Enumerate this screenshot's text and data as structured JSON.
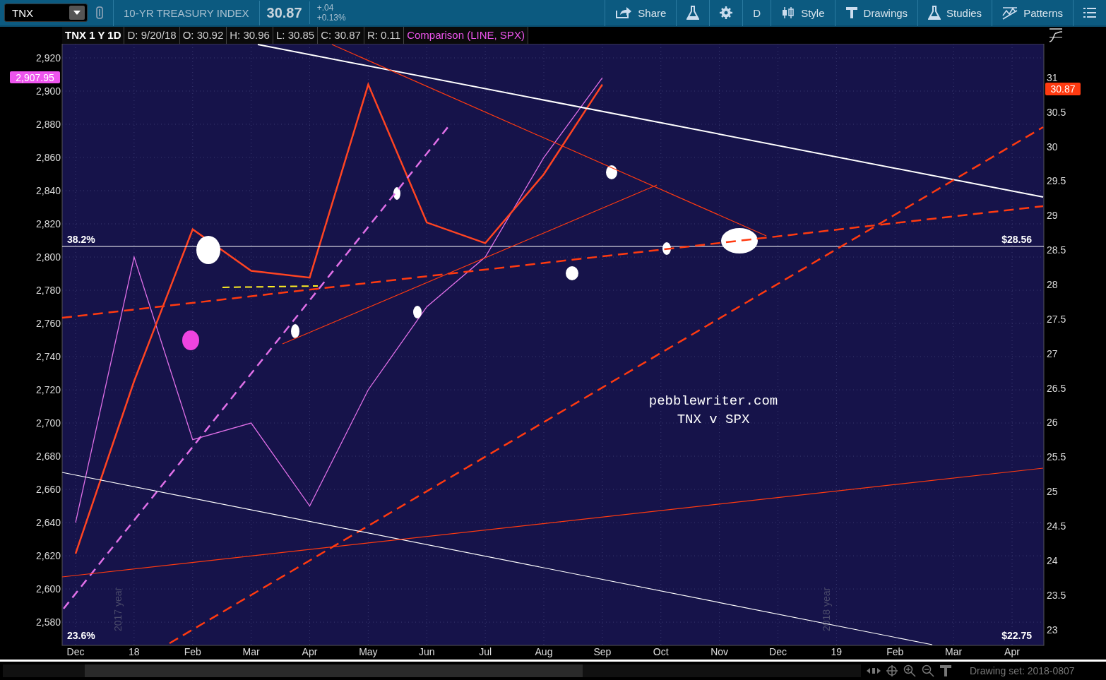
{
  "toolbar": {
    "symbol": "TNX",
    "description": "10-YR TREASURY INDEX",
    "last": "30.87",
    "change": "+.04",
    "change_percent": "+0.13%",
    "buttons": [
      {
        "kind": "share",
        "label": "Share"
      },
      {
        "kind": "flask"
      },
      {
        "kind": "gear"
      },
      {
        "kind": "text",
        "label": "D"
      },
      {
        "kind": "style",
        "label": "Style"
      },
      {
        "kind": "drawings",
        "label": "Drawings"
      },
      {
        "kind": "studies",
        "label": "Studies"
      },
      {
        "kind": "patterns",
        "label": "Patterns"
      },
      {
        "kind": "list"
      }
    ]
  },
  "header": {
    "title": "TNX 1 Y 1D",
    "fields": [
      "D: 9/20/18",
      "O: 30.92",
      "H: 30.96",
      "L: 30.85",
      "C: 30.87",
      "R: 0.11"
    ],
    "comparison": "Comparison (LINE, SPX)"
  },
  "chart": {
    "left_badge": "2,907.95",
    "right_badge": "30.87",
    "fib_levels": [
      {
        "percent": "38.2%",
        "price": "$28.56",
        "kind": "upper"
      },
      {
        "percent": "23.6%",
        "price": "$22.75",
        "kind": "lower"
      }
    ],
    "note_lines": [
      "pebblewriter.com",
      "TNX  v  SPX"
    ],
    "year_marks": [
      "2017 year",
      "2018 year"
    ],
    "chart_data": {
      "type": "line",
      "categories": [
        "Dec",
        "18",
        "Feb",
        "Mar",
        "Apr",
        "May",
        "Jun",
        "Jul",
        "Aug",
        "Sep",
        "Oct",
        "Nov",
        "Dec",
        "19",
        "Feb",
        "Mar",
        "Apr"
      ],
      "grid": true,
      "ylim": [
        2566,
        2928.5
      ],
      "yticks": [
        {
          "value": 2580,
          "label": "2,580"
        },
        {
          "value": 2600,
          "label": "2,600"
        },
        {
          "value": 2620,
          "label": "2,620"
        },
        {
          "value": 2640,
          "label": "2,640"
        },
        {
          "value": 2660,
          "label": "2,660"
        },
        {
          "value": 2680,
          "label": "2,680"
        },
        {
          "value": 2700,
          "label": "2,700"
        },
        {
          "value": 2720,
          "label": "2,720"
        },
        {
          "value": 2740,
          "label": "2,740"
        },
        {
          "value": 2760,
          "label": "2,760"
        },
        {
          "value": 2780,
          "label": "2,780"
        },
        {
          "value": 2800,
          "label": "2,800"
        },
        {
          "value": 2820,
          "label": "2,820"
        },
        {
          "value": 2840,
          "label": "2,840"
        },
        {
          "value": 2860,
          "label": "2,860"
        },
        {
          "value": 2880,
          "label": "2,880"
        },
        {
          "value": 2900,
          "label": "2,900"
        },
        {
          "value": 2920,
          "label": "2,920"
        }
      ],
      "y2lim": [
        22.77,
        31.49
      ],
      "y2ticks": [
        23,
        23.5,
        24,
        24.5,
        25,
        25.5,
        26,
        26.5,
        27,
        27.5,
        28,
        28.5,
        29,
        29.5,
        30,
        30.5,
        31
      ],
      "series": [
        {
          "color": "#e070e8",
          "axis": "y",
          "values": [
            2640,
            2800,
            2690,
            2700,
            2650,
            2720,
            2770,
            2800,
            2860,
            2908,
            null,
            null,
            null,
            null,
            null,
            null,
            null
          ]
        },
        {
          "color": "#ff4422",
          "axis": "y2",
          "values": [
            24.1,
            26.6,
            28.8,
            28.2,
            28.1,
            30.9,
            28.9,
            28.6,
            29.6,
            30.9,
            null,
            null,
            null,
            null,
            null,
            null,
            null
          ]
        }
      ]
    }
  },
  "status_bar": {
    "drawing_set": "Drawing set: 2018-0807"
  }
}
